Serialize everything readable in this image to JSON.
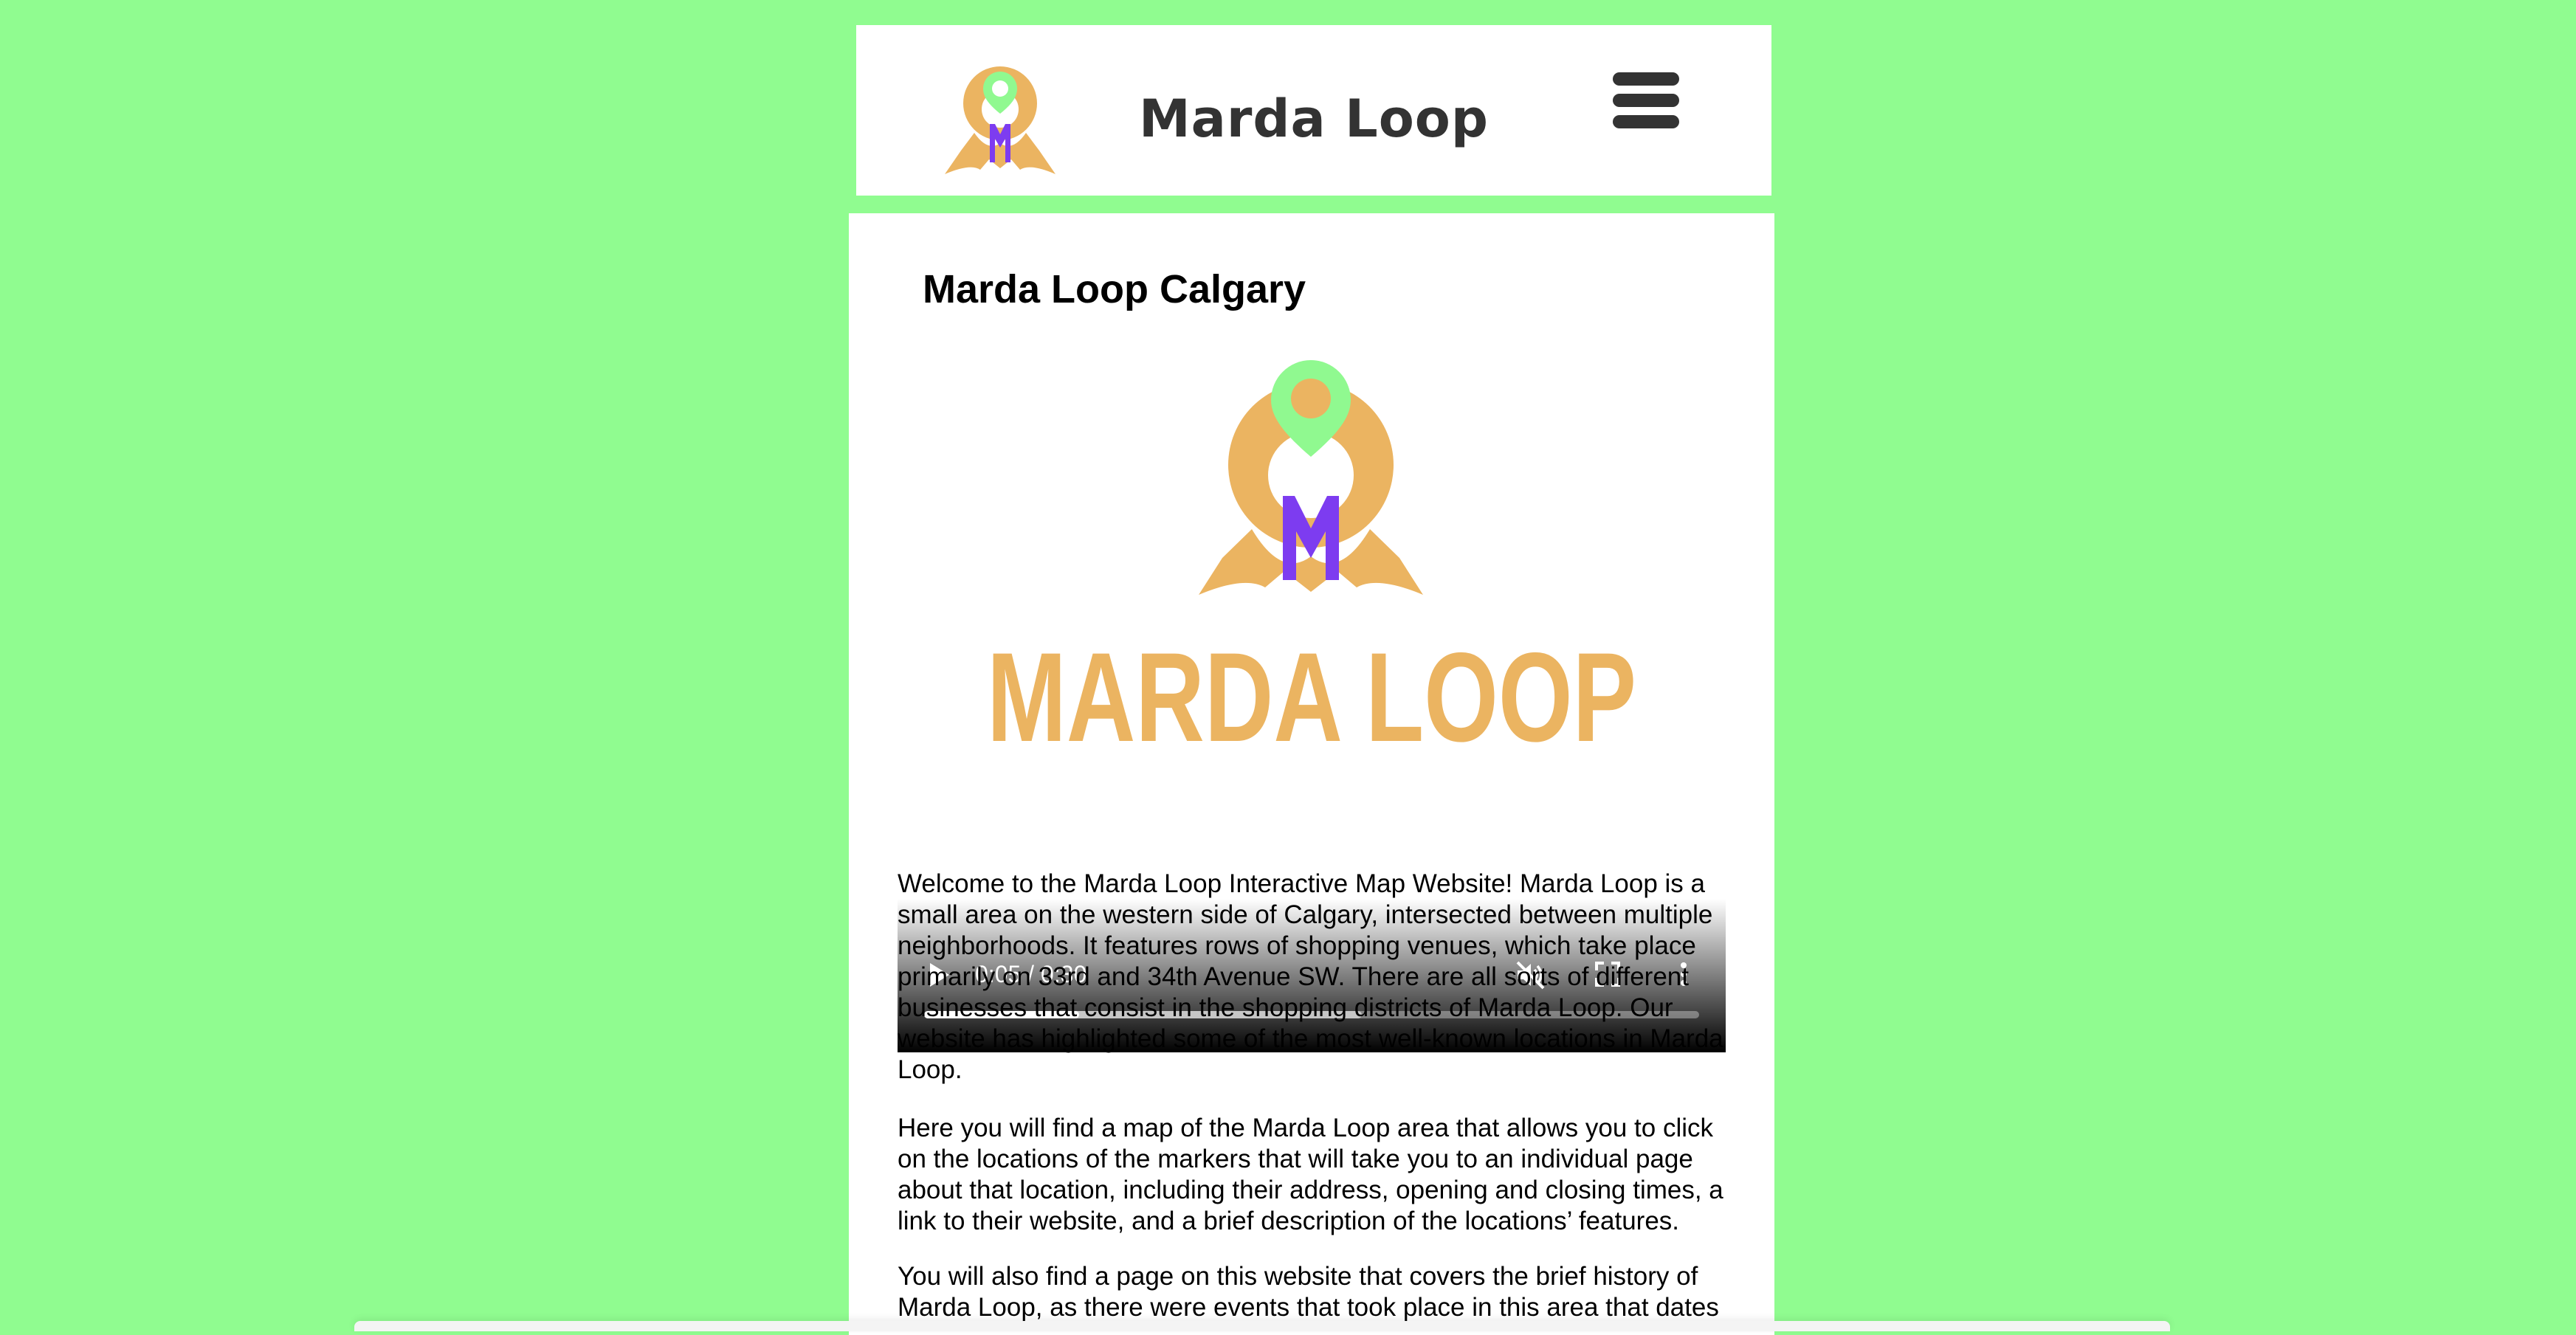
{
  "header": {
    "title": "Marda Loop",
    "menu_icon": "hamburger-menu-icon",
    "logo_icon": "marda-loop-logo"
  },
  "main": {
    "heading": "Marda Loop Calgary",
    "video": {
      "time_display": "0:05 / 0:30",
      "logo_wordmark": "MARDA LOOP",
      "played_fraction": 0.2,
      "buffered_fraction": 0.565,
      "muted": true,
      "icons": [
        "play-icon",
        "mute-icon",
        "fullscreen-icon",
        "more-options-icon"
      ]
    },
    "paragraphs": [
      "Welcome to the Marda Loop Interactive Map Website! Marda Loop is a small area on the western side of Calgary, intersected between multiple neighborhoods. It features rows of shopping venues, which take place primarily on 33rd and 34th Avenue SW. There are all sorts of different businesses that consist in the shopping districts of Marda Loop. Our website has highlighted some of the most well-known locations in Marda Loop.",
      "Here you will find a map of the Marda Loop area that allows you to click on the locations of the markers that will take you to an individual page about that location, including their address, opening and closing times, a link to their website, and a brief description of the locations’ features.",
      "You will also find a page on this website that covers the brief history of Marda Loop, as there were events that took place in this area that dates"
    ]
  },
  "colors": {
    "background": "#90fc90",
    "logo_orange": "#ebb461",
    "logo_pin_green": "#90f990",
    "logo_purple": "#7d3cf0",
    "title_text": "#333333"
  }
}
